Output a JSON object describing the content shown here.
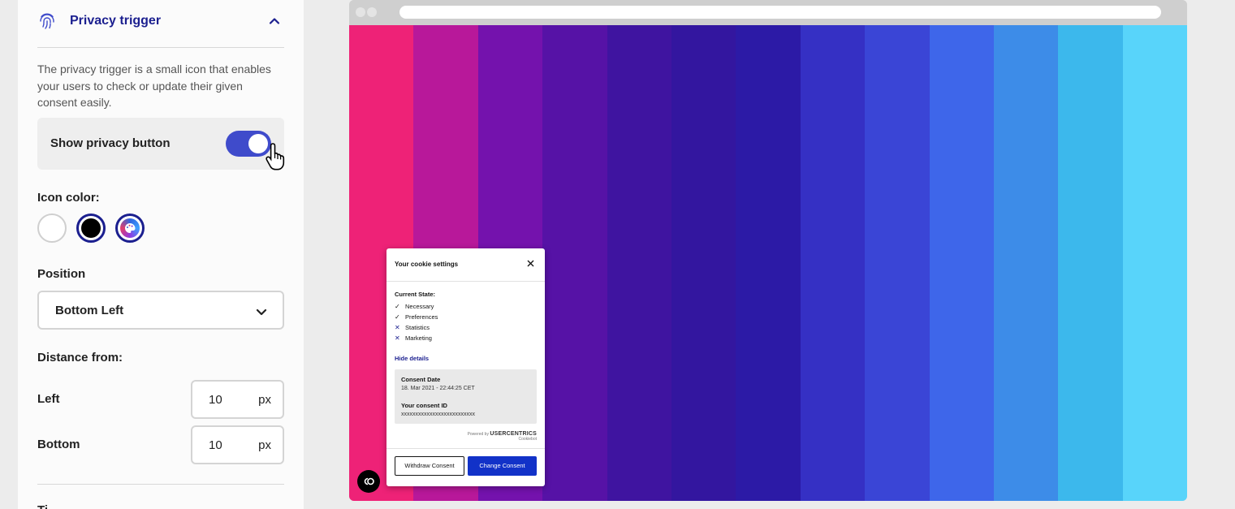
{
  "panel": {
    "title": "Privacy trigger",
    "description": "The privacy trigger is a small icon that enables your users to check or update their given consent easily.",
    "toggle_label": "Show privacy button",
    "toggle_on": true,
    "icon_color_label": "Icon color:",
    "icon_colors": [
      "#ffffff",
      "#000000",
      "custom"
    ],
    "selected_icon_color": "#000000",
    "position_label": "Position",
    "position_value": "Bottom Left",
    "distance_label": "Distance from:",
    "left_label": "Left",
    "left_value": "10",
    "bottom_label": "Bottom",
    "bottom_value": "10",
    "unit": "px",
    "cut_label": "Ti"
  },
  "preview": {
    "stripes": [
      "#ee2277",
      "#b8189a",
      "#7412ad",
      "#5612a6",
      "#3f14a0",
      "#33169f",
      "#2c1aa6",
      "#3530c4",
      "#3a45d6",
      "#3e66ea",
      "#3d8ce8",
      "#3cb8ec",
      "#58d4fa"
    ],
    "popup": {
      "title": "Your cookie settings",
      "state_label": "Current State:",
      "items": [
        {
          "label": "Necessary",
          "status": "✓"
        },
        {
          "label": "Preferences",
          "status": "✓"
        },
        {
          "label": "Statistics",
          "status": "✕"
        },
        {
          "label": "Marketing",
          "status": "✕"
        }
      ],
      "hide_details": "Hide details",
      "consent_date_label": "Consent Date",
      "consent_date_value": "18. Mar 2021 - 22:44:25 CET",
      "consent_id_label": "Your consent ID",
      "consent_id_value": "xxxxxxxxxxxxxxxxxxxxxxxxxx",
      "powered_by": "Powered by",
      "brand": "USERCENTRICS",
      "brand_sub": "Cookiebot",
      "withdraw_label": "Withdraw Consent",
      "change_label": "Change Consent"
    }
  }
}
